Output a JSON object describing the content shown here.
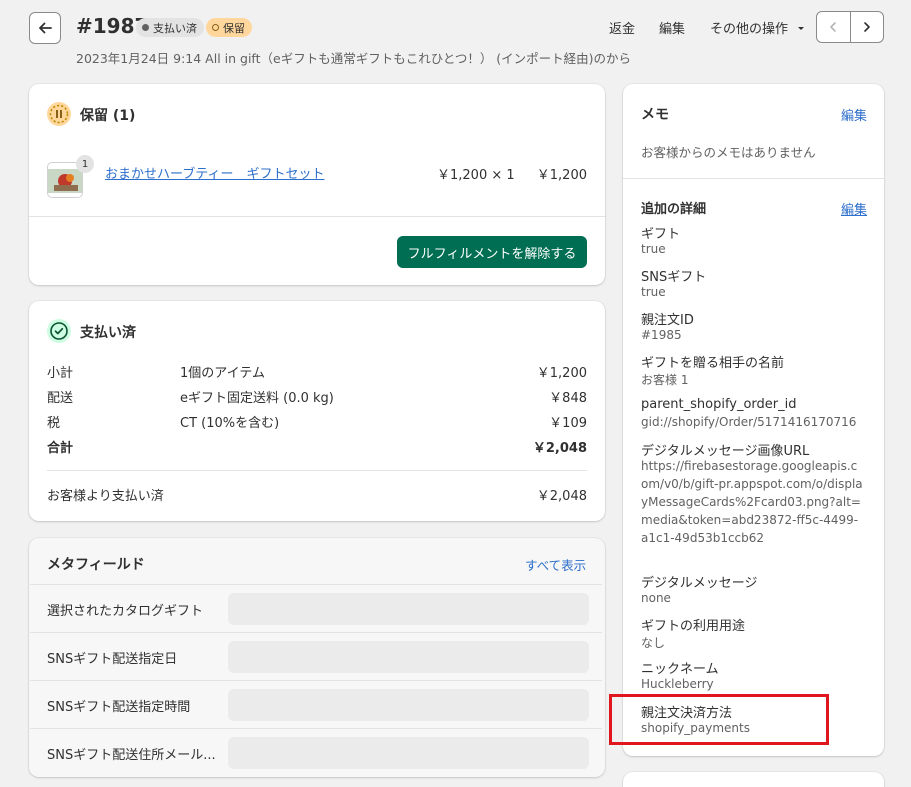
{
  "header": {
    "order_number": "#1987",
    "badge_paid": "支払い済",
    "badge_hold": "保留",
    "subtitle": "2023年1月24日 9:14 All in gift（eギフトも通常ギフトもこれひとつ！） (インポート経由)のから",
    "refund": "返金",
    "edit": "編集",
    "more_actions": "その他の操作"
  },
  "hold_card": {
    "title": "保留 (1)",
    "item_name": "おまかせハーブティー　ギフトセット",
    "item_qty_badge": "1",
    "unit_price": "￥1,200 × 1",
    "line_total": "￥1,200",
    "release_button": "フルフィルメントを解除する"
  },
  "payment_card": {
    "title": "支払い済",
    "rows": [
      {
        "label": "小計",
        "desc": "1個のアイテム",
        "amount": "￥1,200"
      },
      {
        "label": "配送",
        "desc": "eギフト固定送料 (0.0 kg)",
        "amount": "￥848"
      },
      {
        "label": "税",
        "desc": "CT (10%を含む)",
        "amount": "￥109"
      },
      {
        "label": "合計",
        "desc": "",
        "amount": "￥2,048"
      }
    ],
    "paid_by_customer_label": "お客様より支払い済",
    "paid_by_customer_amount": "￥2,048"
  },
  "metafields_card": {
    "title": "メタフィールド",
    "show_all": "すべて表示",
    "fields": [
      {
        "label": "選択されたカタログギフト"
      },
      {
        "label": "SNSギフト配送指定日"
      },
      {
        "label": "SNSギフト配送指定時間"
      },
      {
        "label": "SNSギフト配送住所メール..."
      }
    ]
  },
  "memo_card": {
    "title": "メモ",
    "edit": "編集",
    "empty_text": "お客様からのメモはありません"
  },
  "details_card": {
    "title": "追加の詳細",
    "edit": "編集",
    "items": [
      {
        "key": "ギフト",
        "value": "true"
      },
      {
        "key": "SNSギフト",
        "value": "true"
      },
      {
        "key": "親注文ID",
        "value": "#1985"
      },
      {
        "key": "ギフトを贈る相手の名前",
        "value": "お客様 1"
      },
      {
        "key": "parent_shopify_order_id",
        "value": "gid://shopify/Order/5171416170716"
      },
      {
        "key": "デジタルメッセージ画像URL",
        "value": "https://firebasestorage.googleapis.com/v0/b/gift-pr.appspot.com/o/displayMessageCards%2Fcard03.png?alt=media&token=abd23872-ff5c-4499-a1c1-49d53b1ccb62"
      },
      {
        "key": "デジタルメッセージ",
        "value": "none"
      },
      {
        "key": "ギフトの利用用途",
        "value": "なし"
      },
      {
        "key": "ニックネーム",
        "value": "Huckleberry"
      },
      {
        "key": "親注文決済方法",
        "value": "shopify_payments"
      }
    ]
  },
  "colors": {
    "primary_button": "#006e52",
    "link": "#2c6ecb",
    "hold_badge": "#ffd79d",
    "highlight": "#e0161f"
  }
}
